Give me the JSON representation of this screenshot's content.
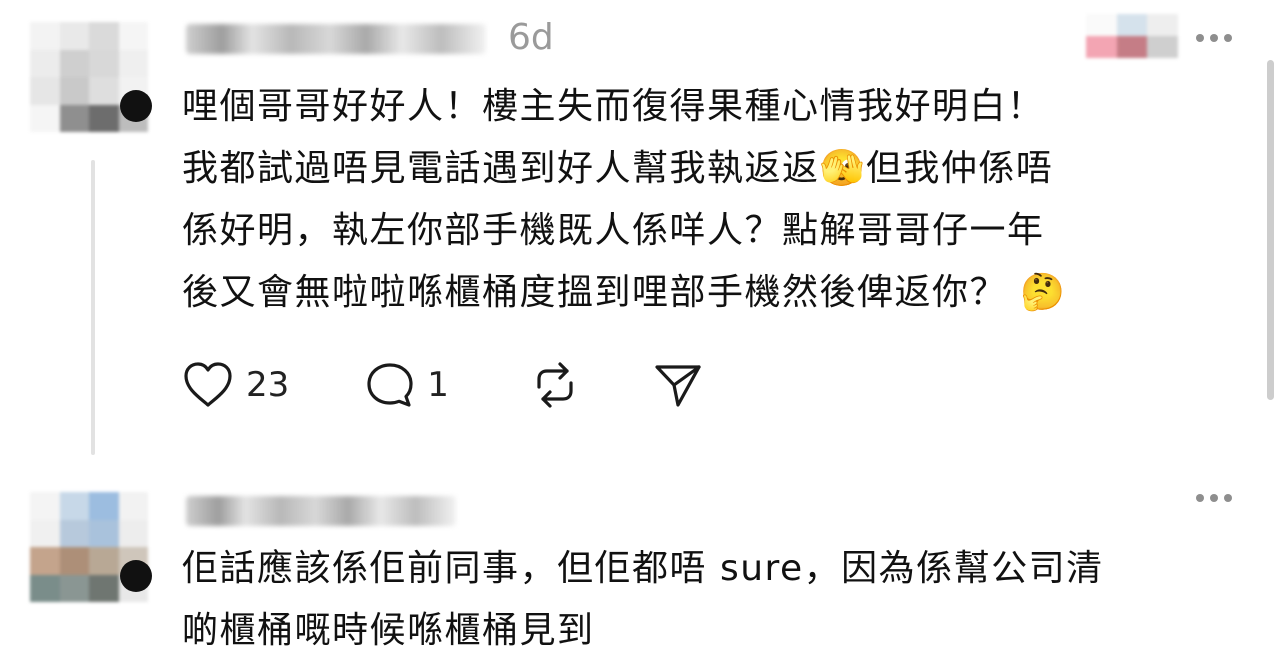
{
  "post1": {
    "time": "6d",
    "text": "哩個哥哥好好人！樓主失而復得果種心情我好明白！\n我都試過唔見電話遇到好人幫我執返返🫣但我仲係唔\n係好明，執左你部手機既人係咩人？點解哥哥仔一年\n後又會無啦啦喺櫃桶度搵到哩部手機然後俾返你？ 🤔",
    "likes": "23",
    "replies": "1"
  },
  "post2": {
    "text": "佢話應該係佢前同事，但佢都唔 sure，因為係幫公司清\n啲櫃桶嘅時候喺櫃桶見到"
  },
  "icons": {
    "like": "heart-outline-icon",
    "reply": "speech-bubble-icon",
    "repost": "repost-arrows-icon",
    "share": "paper-plane-icon",
    "more": "more-dots-icon"
  },
  "colors": {
    "text": "#111111",
    "meta": "#9a9a9a",
    "icon": "#1a1a1a",
    "thread_line": "#e2e2e2"
  }
}
